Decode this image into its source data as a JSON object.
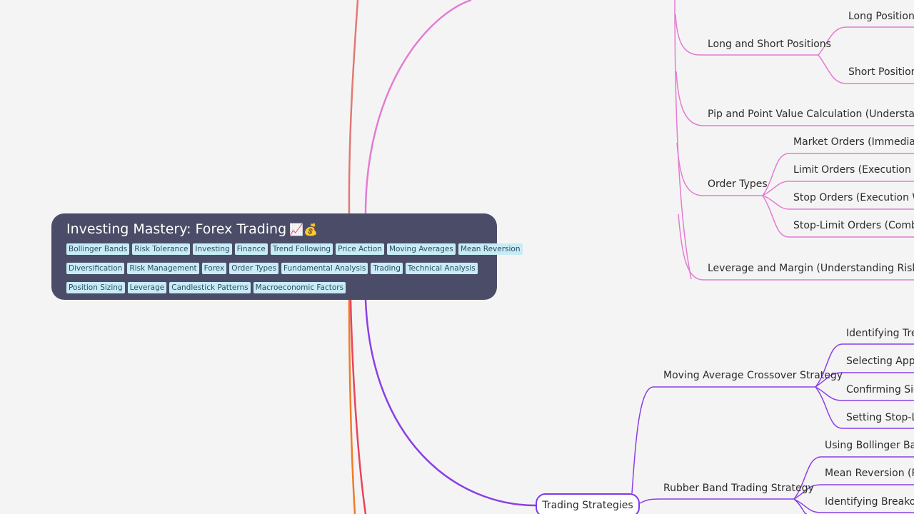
{
  "root": {
    "title": "Investing Mastery: Forex Trading",
    "title_emoji": "📈💰",
    "tag_rows": [
      [
        "Bollinger Bands",
        "Risk Tolerance",
        "Investing",
        "Finance",
        "Trend Following",
        "Price Action",
        "Moving Averages",
        "Mean Reversion"
      ],
      [
        "Diversification",
        "Risk Management",
        "Forex",
        "Order Types",
        "Fundamental Analysis",
        "Trading",
        "Technical Analysis"
      ],
      [
        "Position Sizing",
        "Leverage",
        "Candlestick Patterns",
        "Macroeconomic Factors"
      ]
    ]
  },
  "branches": {
    "pink": {
      "color": "#e47bd3",
      "long_short": "Long and Short Positions",
      "long_positions": "Long Positions (",
      "short_positions": "Short Positions",
      "pip_value": "Pip and Point Value Calculation (Understanding P",
      "order_types": "Order Types",
      "market_orders": "Market Orders (Immediate Ex",
      "limit_orders": "Limit Orders (Execution at Sp",
      "stop_orders": "Stop Orders (Execution Wher",
      "stop_limit_orders": "Stop-Limit Orders (Combinat",
      "leverage_margin": "Leverage and Margin (Understanding Risk and Re"
    },
    "purple": {
      "color": "#8b3fe6",
      "trading_strategies": "Trading Strategies",
      "ma_crossover": "Moving Average Crossover Strategy",
      "identifying_trend": "Identifying Trend",
      "selecting_appro": "Selecting Appro",
      "confirming_sign": "Confirming Sign",
      "setting_stop": "Setting Stop-Los",
      "rubber_band": "Rubber Band Trading Strategy",
      "using_bollinger": "Using Bollinger Band",
      "mean_reversion": "Mean Reversion (Pric",
      "identifying_breakout": "Identifying Breakout"
    },
    "other_colors": {
      "salmon": "#e07a72",
      "orange": "#f07a2a",
      "red": "#e8445a"
    }
  }
}
